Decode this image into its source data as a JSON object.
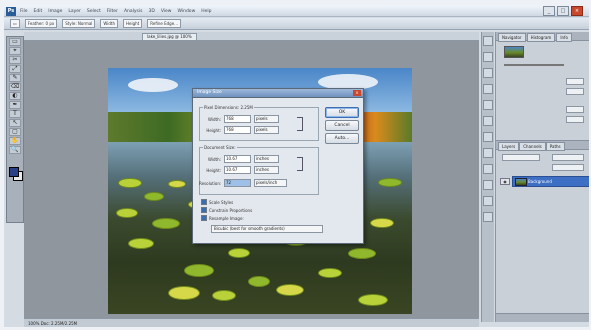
{
  "menu": {
    "logo": "Ps",
    "items": [
      "File",
      "Edit",
      "Image",
      "Layer",
      "Select",
      "Filter",
      "Analysis",
      "3D",
      "View",
      "Window",
      "Help"
    ],
    "window_buttons": [
      "_",
      "□",
      "×"
    ]
  },
  "options": {
    "tool_icon": "marquee-icon",
    "controls": [
      "Feather: 0 px",
      "Style: Normal",
      "Width",
      "Height",
      "Refine Edge..."
    ]
  },
  "document": {
    "tab_label": "lake_lilies.jpg @ 100%"
  },
  "toolbox": {
    "tools": [
      "▭",
      "⌖",
      "✂",
      "⤢",
      "✎",
      "⌫",
      "◐",
      "✒",
      "T",
      "↖",
      "▢",
      "✋",
      "🔍",
      "◔",
      "◎",
      "⬚"
    ]
  },
  "dialog": {
    "title": "Image Size",
    "close": "×",
    "pixel_dims": {
      "label": "Pixel Dimensions: 2.25M",
      "width_label": "Width:",
      "width_value": "768",
      "width_unit": "pixels",
      "height_label": "Height:",
      "height_value": "768",
      "height_unit": "pixels"
    },
    "doc_size": {
      "label": "Document Size:",
      "width_label": "Width:",
      "width_value": "10.67",
      "width_unit": "inches",
      "height_label": "Height:",
      "height_value": "10.67",
      "height_unit": "inches",
      "res_label": "Resolution:",
      "res_value": "72",
      "res_unit": "pixels/inch"
    },
    "buttons": {
      "ok": "OK",
      "cancel": "Cancel",
      "auto": "Auto..."
    },
    "checks": {
      "scale_styles": "Scale Styles",
      "constrain": "Constrain Proportions",
      "resample": "Resample Image:"
    },
    "resample_method": "Bicubic (best for smooth gradients)"
  },
  "panels": {
    "top_tabs": [
      "Navigator",
      "Histogram",
      "Info"
    ],
    "layer_tabs": [
      "Layers",
      "Channels",
      "Paths"
    ],
    "layer_name": "Background"
  },
  "status": {
    "text": "100%  Doc: 2.25M/2.25M"
  },
  "colors": {
    "foreground": "#2a3f86",
    "background": "#eaeaea",
    "selection": "#3d6fc4"
  }
}
